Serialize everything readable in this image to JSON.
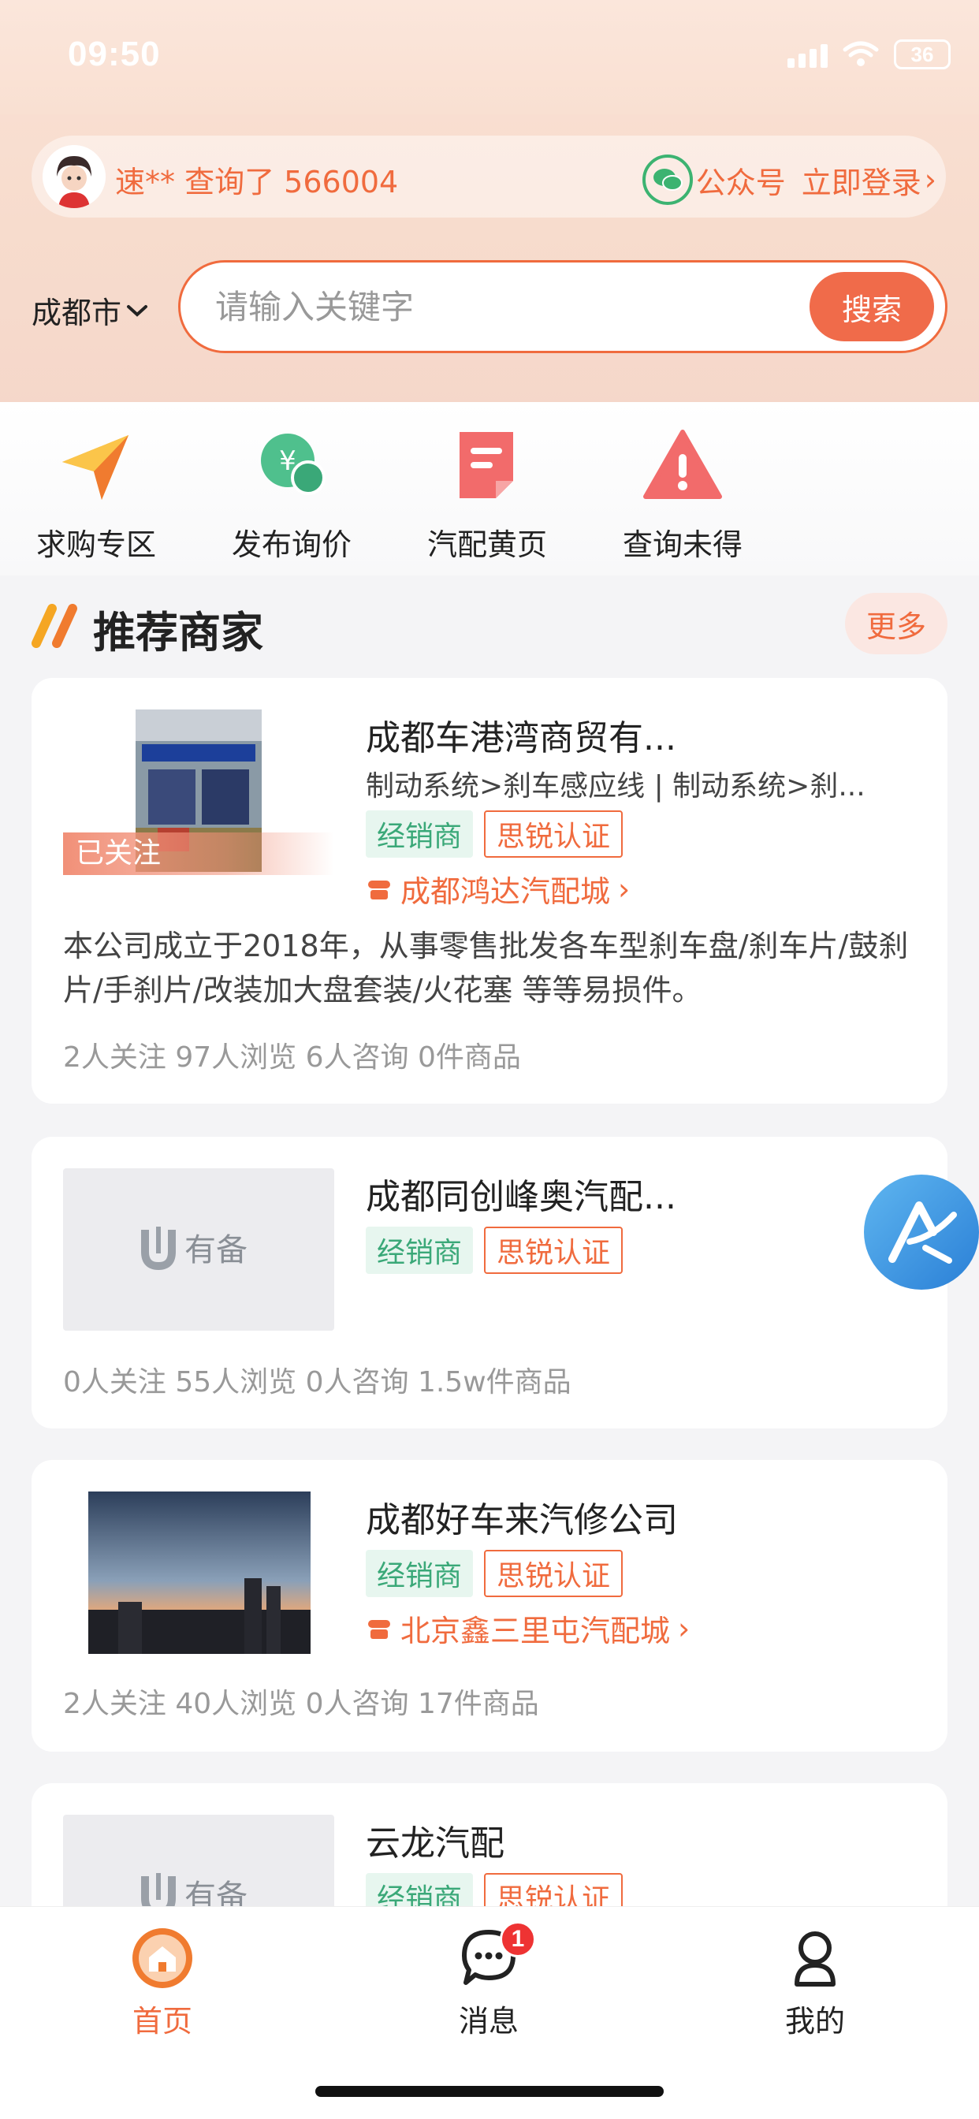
{
  "status_bar": {
    "time": "09:50",
    "battery": "36"
  },
  "header": {
    "query_text": "速** 查询了 566004",
    "wechat_label": "公众号",
    "login_label": "立即登录"
  },
  "search": {
    "city": "成都市",
    "placeholder": "请输入关键字",
    "button": "搜索"
  },
  "quick_nav": [
    {
      "label": "求购专区",
      "icon": "paper-plane-icon"
    },
    {
      "label": "发布询价",
      "icon": "yuan-chat-icon"
    },
    {
      "label": "汽配黄页",
      "icon": "document-icon"
    },
    {
      "label": "查询未得",
      "icon": "warning-icon"
    }
  ],
  "section": {
    "title": "推荐商家",
    "more": "更多"
  },
  "merchants": [
    {
      "name": "成都车港湾商贸有...",
      "category": "制动系统>刹车感应线 | 制动系统>刹...",
      "tags": [
        "经销商",
        "思锐认证"
      ],
      "followed": "已关注",
      "market": "成都鸿达汽配城",
      "description": "本公司成立于2018年，从事零售批发各车型刹车盘/刹车片/鼓刹片/手刹片/改装加大盘套装/火花塞 等等易损件。",
      "stats": "2人关注 97人浏览 6人咨询 0件商品"
    },
    {
      "name": "成都同创峰奥汽配...",
      "tags": [
        "经销商",
        "思锐认证"
      ],
      "placeholder_logo": "有备",
      "stats": "0人关注 55人浏览 0人咨询 1.5w件商品"
    },
    {
      "name": "成都好车来汽修公司",
      "tags": [
        "经销商",
        "思锐认证"
      ],
      "market": "北京鑫三里屯汽配城",
      "stats": "2人关注 40人浏览 0人咨询 17件商品"
    },
    {
      "name": "云龙汽配",
      "tags": [
        "经销商",
        "思锐认证"
      ],
      "placeholder_logo": "有备"
    }
  ],
  "tabbar": {
    "home": "首页",
    "messages": "消息",
    "messages_badge": "1",
    "mine": "我的"
  },
  "colors": {
    "accent": "#f06b3e",
    "green_tag": "#3aa878"
  }
}
